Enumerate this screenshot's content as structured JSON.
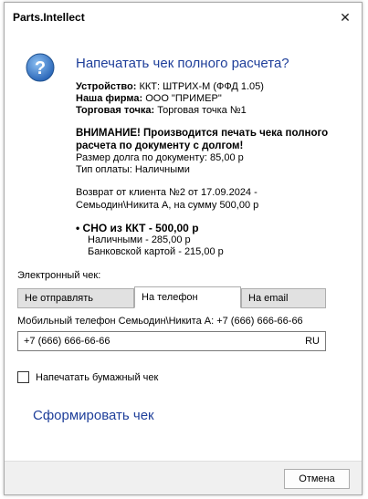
{
  "window": {
    "title": "Parts.Intellect",
    "close_glyph": "✕"
  },
  "dialog": {
    "icon": "question-icon",
    "heading": "Напечатать чек полного расчета?",
    "device_label": "Устройство:",
    "device_value": "ККТ: ШТРИХ-М (ФФД 1.05)",
    "company_label": "Наша фирма:",
    "company_value": "ООО \"ПРИМЕР\"",
    "point_label": "Торговая точка:",
    "point_value": "Торговая точка №1",
    "warning_line1": "ВНИМАНИЕ! Производится печать чека полного",
    "warning_line2": "расчета по документу с долгом!",
    "debt_line": "Размер долга по документу: 85,00 р",
    "payment_type_line": "Тип оплаты: Наличными",
    "refund_line1": "Возврат от клиента №2 от 17.09.2024 -",
    "refund_line2": "Семьодин\\Никита А, на сумму 500,00 р",
    "sno_line": "• СНО из ККТ - 500,00 р",
    "cash_line": "Наличными - 285,00 р",
    "card_line": "Банковской картой - 215,00 р",
    "electronic_label": "Электронный чек:",
    "tabs": [
      {
        "label": "Не отправлять",
        "active": false
      },
      {
        "label": "На телефон",
        "active": true
      },
      {
        "label": "На email",
        "active": false
      }
    ],
    "phone_label": "Мобильный телефон Семьодин\\Никита А: +7 (666) 666-66-66",
    "phone_value": "+7 (666) 666-66-66",
    "phone_locale": "RU",
    "paper_check_label": "Напечатать бумажный чек",
    "paper_check_checked": false,
    "form_link": "Сформировать чек",
    "cancel_label": "Отмена"
  },
  "colors": {
    "accent": "#1f3f9a",
    "icon_bg": "#3a78c9"
  }
}
